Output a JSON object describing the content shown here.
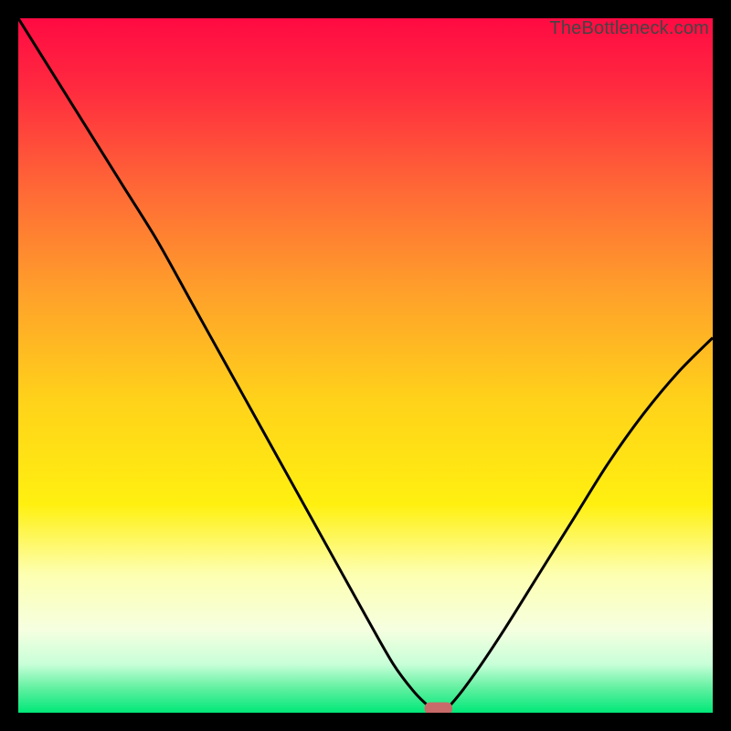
{
  "watermark": "TheBottleneck.com",
  "palette": {
    "frame": "#000000",
    "curve": "#000000",
    "marker": "#c96a6a"
  },
  "chart_data": {
    "type": "line",
    "title": "",
    "xlabel": "",
    "ylabel": "",
    "xlim": [
      0,
      100
    ],
    "ylim": [
      0,
      100
    ],
    "gradient_stops": [
      {
        "offset": 0.0,
        "color": "#ff0a43"
      },
      {
        "offset": 0.1,
        "color": "#ff2a3f"
      },
      {
        "offset": 0.25,
        "color": "#ff6a36"
      },
      {
        "offset": 0.4,
        "color": "#ffa22a"
      },
      {
        "offset": 0.55,
        "color": "#ffd21a"
      },
      {
        "offset": 0.7,
        "color": "#fff010"
      },
      {
        "offset": 0.8,
        "color": "#fdffb0"
      },
      {
        "offset": 0.88,
        "color": "#f6ffe0"
      },
      {
        "offset": 0.93,
        "color": "#c8ffd8"
      },
      {
        "offset": 0.965,
        "color": "#60f0a0"
      },
      {
        "offset": 1.0,
        "color": "#00e878"
      }
    ],
    "series": [
      {
        "name": "bottleneck-curve",
        "x": [
          0,
          5,
          10,
          15,
          20,
          25,
          30,
          35,
          40,
          45,
          50,
          54,
          57,
          59,
          60,
          61,
          63,
          66,
          70,
          75,
          80,
          85,
          90,
          95,
          100
        ],
        "y": [
          100,
          92,
          84,
          76,
          68,
          59,
          50,
          41,
          32,
          23,
          14,
          7,
          3,
          1,
          0,
          0,
          2,
          6,
          12,
          20,
          28,
          36,
          43,
          49,
          54
        ]
      }
    ],
    "marker": {
      "x": 60.5,
      "y": 0,
      "w": 4,
      "h": 1.5
    }
  }
}
